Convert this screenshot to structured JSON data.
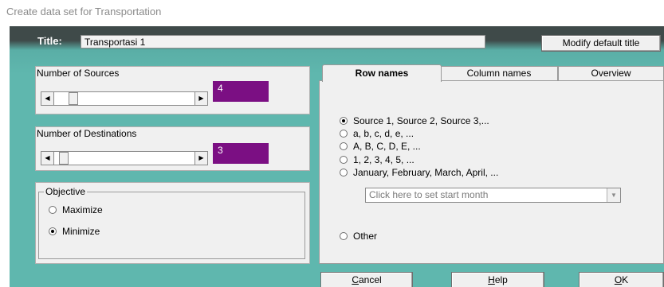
{
  "window_title": "Create data set for Transportation",
  "title_label": "Title:",
  "title_value": "Transportasi 1",
  "modify_default_title": "Modify default title",
  "sources": {
    "label": "Number of Sources",
    "value": "4"
  },
  "destinations": {
    "label": "Number of Destinations",
    "value": "3"
  },
  "objective": {
    "label": "Objective",
    "options": [
      {
        "label": "Maximize",
        "selected": false
      },
      {
        "label": "Minimize",
        "selected": true
      }
    ]
  },
  "tabs": [
    {
      "label": "Row names",
      "active": true
    },
    {
      "label": "Column names",
      "active": false
    },
    {
      "label": "Overview",
      "active": false
    }
  ],
  "row_names": {
    "options": [
      {
        "label": "Source 1, Source 2, Source 3,...",
        "selected": true
      },
      {
        "label": "a, b, c, d, e, ...",
        "selected": false
      },
      {
        "label": "A, B, C, D, E, ...",
        "selected": false
      },
      {
        "label": "1, 2, 3, 4, 5, ...",
        "selected": false
      },
      {
        "label": "January, February, March, April, ...",
        "selected": false
      }
    ],
    "start_month_placeholder": "Click here to set start month",
    "other_label": "Other"
  },
  "buttons": {
    "cancel": {
      "accel": "C",
      "rest": "ancel"
    },
    "help": {
      "accel": "H",
      "rest": "elp"
    },
    "ok": {
      "accel": "O",
      "rest": "K"
    }
  }
}
